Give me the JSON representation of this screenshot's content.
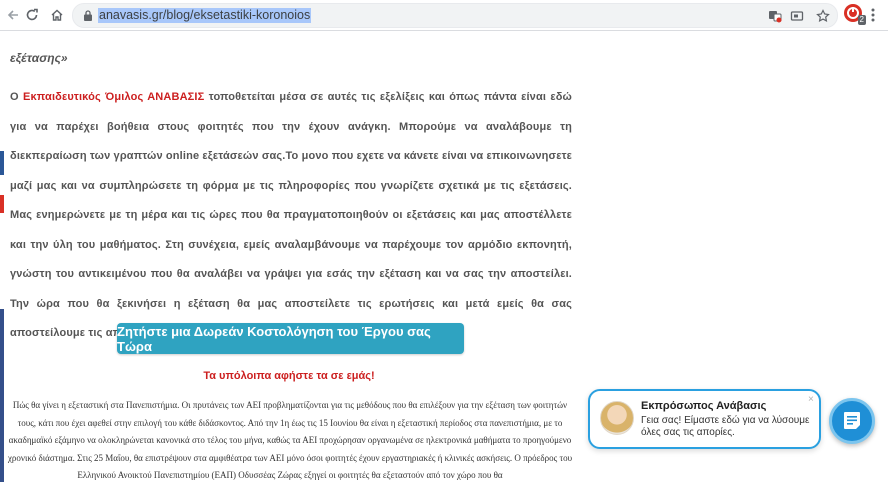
{
  "browser": {
    "url": "anavasis.gr/blog/eksetastiki-koronoios",
    "extension_badge_count": "2"
  },
  "article": {
    "intro_fragment": "εξέτασης»",
    "brand_name": "Εκπαιδευτικός Όμιλος ΑΝΑΒΑΣΙΣ",
    "paragraph_prefix": "Ο ",
    "paragraph_body": " τοποθετείται μέσα σε αυτές τις εξελίξεις και όπως πάντα είναι εδώ για να παρέχει βοήθεια στους φοιτητές που την έχουν ανάγκη. Μπορούμε να αναλάβουμε τη διεκπεραίωση των γραπτών online εξετάσεών σας.Το μονο που εχετε να κάνετε είναι να επικοινωνησετε μαζί μας και να συμπληρώσετε τη φόρμα με τις πληροφορίες που γνωρίζετε σχετικά με τις εξετάσεις. Μας ενημερώνετε με τη μέρα και τις ώρες που θα πραγματοποιηθούν οι εξετάσεις και μας αποστέλλετε και την ύλη του μαθήματος. Στη συνέχεια, εμείς αναλαμβάνουμε να παρέχουμε τον αρμόδιο εκπονητή, γνώστη του αντικειμένου που θα αναλάβει να γράψει για εσάς την εξέταση και να σας την αποστείλει. Την ώρα που θα ξεκινήσει η εξέταση θα μας αποστείλετε τις ερωτήσεις και μετά εμείς θα σας αποστείλουμε τις απαντήσεις μέσα στο χρονικό περιθώριο που πρέπει.",
    "cta_label": "Ζητήστε μια Δωρεάν Κοστολόγηση του Έργου σας Τώρα",
    "cta_subtext": "Τα υπόλοιπα αφήστε τα σε εμάς!",
    "news_text": "Πώς θα γίνει η εξεταστική στα Πανεπιστήμια. Οι πρυτάνεις των ΑΕΙ προβληματίζονται για τις μεθόδους που θα επιλέξουν για την εξέταση των φοιτητών τους, κάτι που έχει αφεθεί στην επιλογή του κάθε διδάσκοντος. Από την 1η έως τις 15 Ιουνίου θα είναι η εξεταστική περίοδος στα πανεπιστήμια, με το ακαδημαϊκό εξάμηνο να ολοκληρώνεται κανονικά στο τέλος του μήνα, καθώς τα ΑΕΙ προχώρησαν οργανωμένα σε ηλεκτρονικά μαθήματα το προηγούμενο χρονικό διάστημα. Στις 25 Μαΐου, θα επιστρέψουν στα αμφιθέατρα των ΑΕΙ μόνο όσοι φοιτητές έχουν εργαστηριακές ή κλινικές ασκήσεις. Ο πρόεδρος του Ελληνικού Ανοικτού Πανεπιστημίου (ΕΑΠ) Οδυσσέας Ζώρας εξηγεί οι φοιτητές θα εξεταστούν από τον χώρο που θα"
  },
  "chat": {
    "agent_name": "Εκπρόσωπος Ανάβασις",
    "message": "Γεια σας! Είμαστε εδώ για να λύσουμε όλες σας τις απορίες.",
    "close_symbol": "×"
  },
  "colors": {
    "brand_red": "#cc1f1f",
    "cta_blue": "#2fa3c1",
    "chat_blue": "#1f8fd6",
    "text_gray": "#555555"
  }
}
